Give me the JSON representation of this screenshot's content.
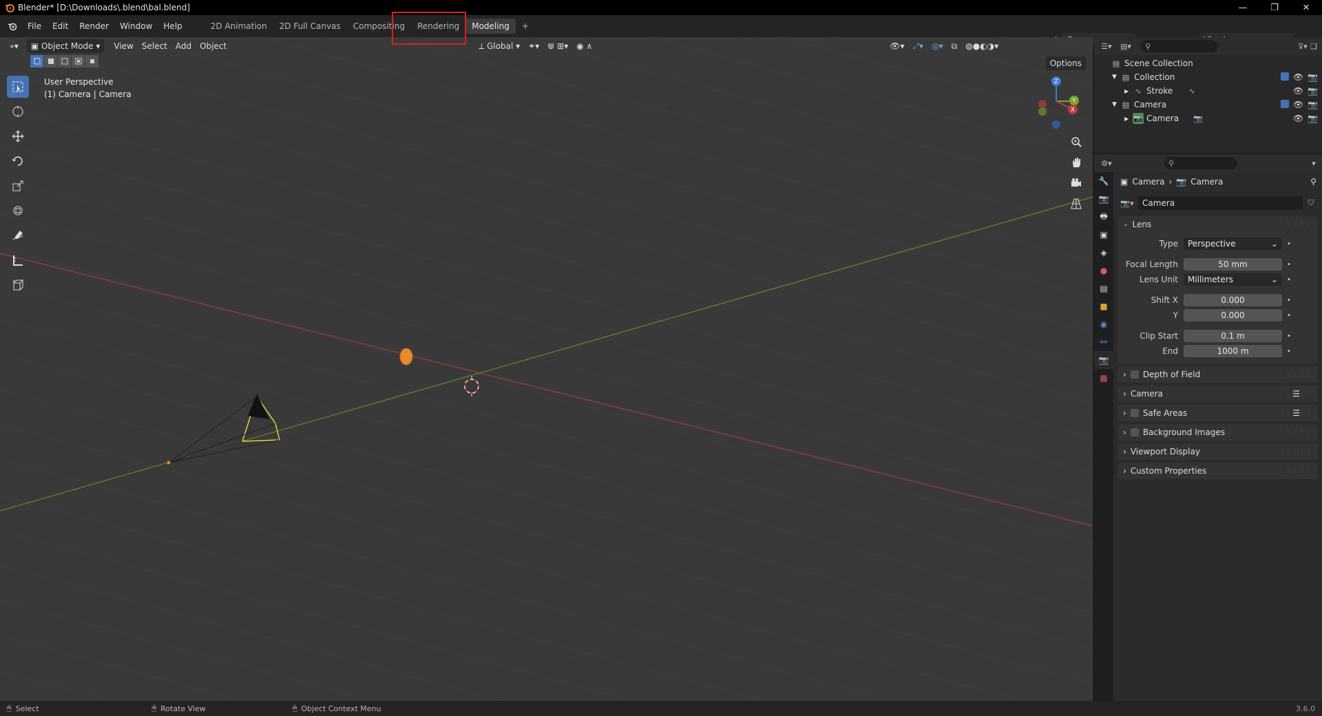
{
  "window": {
    "title": "Blender* [D:\\Downloads\\.blend\\bal.blend]"
  },
  "menu": [
    "File",
    "Edit",
    "Render",
    "Window",
    "Help"
  ],
  "workspace_tabs": [
    {
      "label": "2D Animation",
      "active": false
    },
    {
      "label": "2D Full Canvas",
      "active": false
    },
    {
      "label": "Compositing",
      "active": false
    },
    {
      "label": "Rendering",
      "active": false
    },
    {
      "label": "Modeling",
      "active": true
    }
  ],
  "add_tab_label": "+",
  "scene": {
    "name": "Scene"
  },
  "view_layer": {
    "name": "ViewLayer"
  },
  "viewport": {
    "mode": "Object Mode",
    "menus": [
      "View",
      "Select",
      "Add",
      "Object"
    ],
    "transform_orientation": "Global",
    "options_label": "Options",
    "info_line1": "User Perspective",
    "info_line2": "(1) Camera | Camera",
    "gizmo_labels": {
      "z": "Z",
      "y": "Y",
      "x": "X"
    }
  },
  "outliner": {
    "root": "Scene Collection",
    "rows": [
      {
        "label": "Collection",
        "indent": 1,
        "expanded": true
      },
      {
        "label": "Stroke",
        "indent": 2,
        "expanded": false
      },
      {
        "label": "Camera",
        "indent": 1,
        "expanded": true
      },
      {
        "label": "Camera",
        "indent": 2,
        "expanded": false
      }
    ]
  },
  "properties": {
    "breadcrumb": [
      "Camera",
      "Camera"
    ],
    "datablock_name": "Camera",
    "lens_panel": {
      "title": "Lens",
      "type_label": "Type",
      "type_value": "Perspective",
      "focal_label": "Focal Length",
      "focal_value": "50 mm",
      "lens_unit_label": "Lens Unit",
      "lens_unit_value": "Millimeters",
      "shift_x_label": "Shift X",
      "shift_x_value": "0.000",
      "shift_y_label": "Y",
      "shift_y_value": "0.000",
      "clip_start_label": "Clip Start",
      "clip_start_value": "0.1 m",
      "clip_end_label": "End",
      "clip_end_value": "1000 m"
    },
    "panels": [
      {
        "label": "Depth of Field",
        "checkbox": true
      },
      {
        "label": "Camera",
        "checkbox": false,
        "list_icon": true
      },
      {
        "label": "Safe Areas",
        "checkbox": true,
        "list_icon": true
      },
      {
        "label": "Background Images",
        "checkbox": true
      },
      {
        "label": "Viewport Display",
        "checkbox": false
      },
      {
        "label": "Custom Properties",
        "checkbox": false
      }
    ]
  },
  "statusbar": {
    "select": "Select",
    "rotate": "Rotate View",
    "context": "Object Context Menu",
    "version": "3.6.0"
  },
  "colors": {
    "accent": "#4772b3",
    "x_axis": "#c0393c",
    "y_axis": "#7aa52c",
    "z_axis": "#3b7ddb",
    "highlight": "#e0201c",
    "selection": "#e5d43a"
  }
}
